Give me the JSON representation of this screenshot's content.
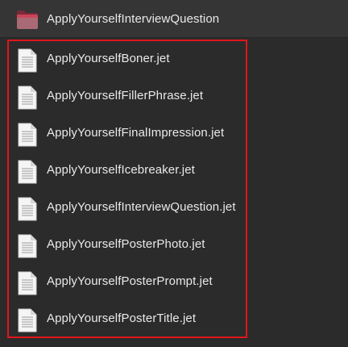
{
  "folder": {
    "name": "ApplyYourselfInterviewQuestion",
    "icon": "folder-icon",
    "icon_color": "#c9445a"
  },
  "files": [
    {
      "name": "ApplyYourselfBoner.jet",
      "icon": "document-icon"
    },
    {
      "name": "ApplyYourselfFillerPhrase.jet",
      "icon": "document-icon"
    },
    {
      "name": "ApplyYourselfFinalImpression.jet",
      "icon": "document-icon"
    },
    {
      "name": "ApplyYourselfIcebreaker.jet",
      "icon": "document-icon"
    },
    {
      "name": "ApplyYourselfInterviewQuestion.jet",
      "icon": "document-icon"
    },
    {
      "name": "ApplyYourselfPosterPhoto.jet",
      "icon": "document-icon"
    },
    {
      "name": "ApplyYourselfPosterPrompt.jet",
      "icon": "document-icon"
    },
    {
      "name": "ApplyYourselfPosterTitle.jet",
      "icon": "document-icon"
    }
  ],
  "highlight_color": "#e0161b"
}
